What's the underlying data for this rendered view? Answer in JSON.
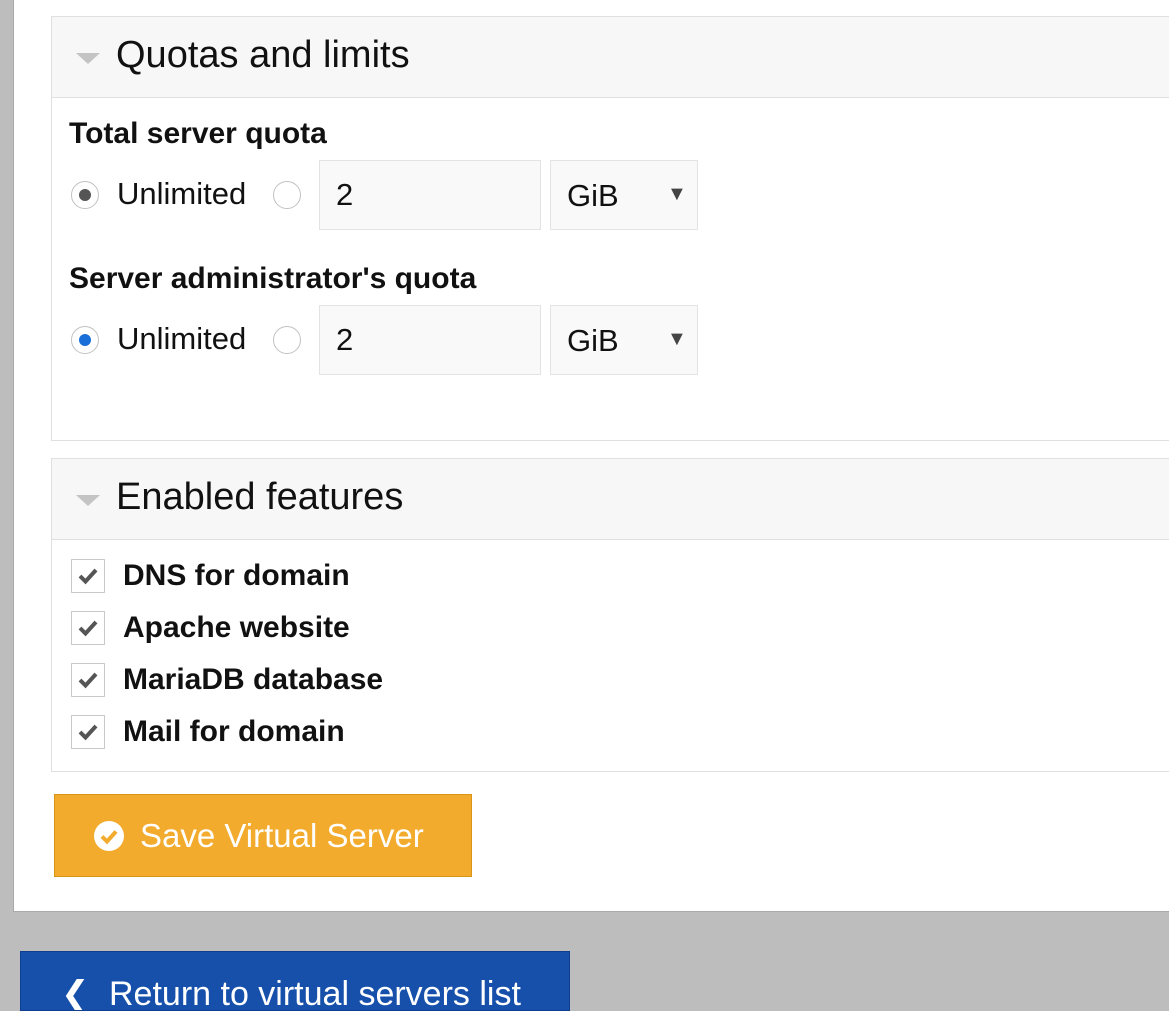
{
  "quotas": {
    "title": "Quotas and limits",
    "total": {
      "label": "Total server quota",
      "unlimited_label": "Unlimited",
      "selected": "unlimited",
      "value": "2",
      "unit": "GiB"
    },
    "admin": {
      "label": "Server administrator's quota",
      "unlimited_label": "Unlimited",
      "selected": "unlimited",
      "value": "2",
      "unit": "GiB"
    }
  },
  "features": {
    "title": "Enabled features",
    "items": [
      {
        "label": "DNS for domain",
        "checked": true
      },
      {
        "label": "Apache website",
        "checked": true
      },
      {
        "label": "MariaDB database",
        "checked": true
      },
      {
        "label": "Mail for domain",
        "checked": true
      }
    ]
  },
  "actions": {
    "save_label": "Save Virtual Server",
    "return_label": "Return to virtual servers list"
  },
  "colors": {
    "save_button": "#f2ab2c",
    "return_button": "#1650ab",
    "radio_active": "#1a6ed8",
    "radio_default": "#555555"
  },
  "icons": {
    "section_toggle": "triangle-down-icon",
    "checkbox": "checkmark-icon",
    "save": "check-circle-icon",
    "return": "arrow-left-icon"
  }
}
